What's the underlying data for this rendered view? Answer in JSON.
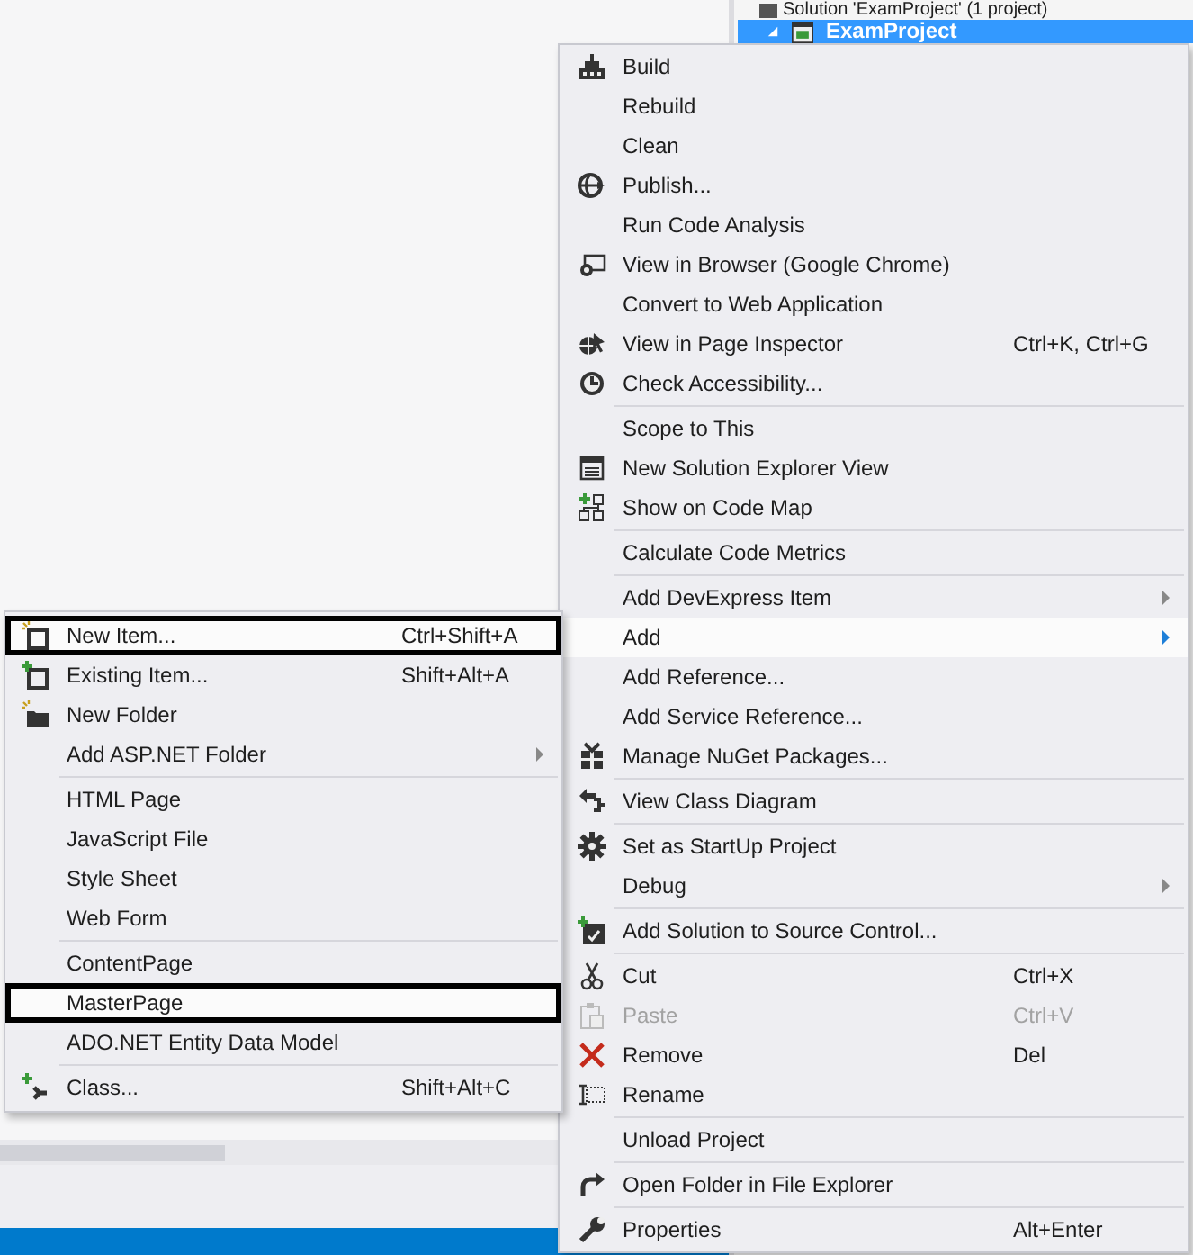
{
  "solution_explorer": {
    "root": "Solution 'ExamProject' (1 project)",
    "project": {
      "label": "ExamProject",
      "expanded": true,
      "selected": true
    }
  },
  "context_menu": {
    "items": [
      {
        "kind": "item",
        "label": "Build",
        "submenu": false,
        "disabled": false,
        "selected": false
      },
      {
        "kind": "item",
        "label": "Rebuild",
        "submenu": false,
        "disabled": false,
        "selected": false
      },
      {
        "kind": "item",
        "label": "Clean",
        "submenu": false,
        "disabled": false,
        "selected": false
      },
      {
        "kind": "item",
        "label": "Publish...",
        "submenu": false,
        "disabled": false,
        "selected": false
      },
      {
        "kind": "item",
        "label": "Run Code Analysis",
        "submenu": false,
        "disabled": false,
        "selected": false
      },
      {
        "kind": "item",
        "label": "View in Browser (Google Chrome)",
        "submenu": false,
        "disabled": false,
        "selected": false
      },
      {
        "kind": "item",
        "label": "Convert to Web Application",
        "submenu": false,
        "disabled": false,
        "selected": false
      },
      {
        "kind": "item",
        "label": "View in Page Inspector",
        "shortcut": "Ctrl+K, Ctrl+G",
        "submenu": false,
        "disabled": false,
        "selected": false
      },
      {
        "kind": "item",
        "label": "Check Accessibility...",
        "submenu": false,
        "disabled": false,
        "selected": false
      },
      {
        "kind": "separator"
      },
      {
        "kind": "item",
        "label": "Scope to This",
        "submenu": false,
        "disabled": false,
        "selected": false
      },
      {
        "kind": "item",
        "label": "New Solution Explorer View",
        "submenu": false,
        "disabled": false,
        "selected": false
      },
      {
        "kind": "item",
        "label": "Show on Code Map",
        "submenu": false,
        "disabled": false,
        "selected": false
      },
      {
        "kind": "separator"
      },
      {
        "kind": "item",
        "label": "Calculate Code Metrics",
        "submenu": false,
        "disabled": false,
        "selected": false
      },
      {
        "kind": "separator"
      },
      {
        "kind": "item",
        "label": "Add DevExpress Item",
        "submenu": true,
        "disabled": false,
        "selected": false
      },
      {
        "kind": "item",
        "label": "Add",
        "submenu": true,
        "disabled": false,
        "selected": true
      },
      {
        "kind": "item",
        "label": "Add Reference...",
        "submenu": false,
        "disabled": false,
        "selected": false
      },
      {
        "kind": "item",
        "label": "Add Service Reference...",
        "submenu": false,
        "disabled": false,
        "selected": false
      },
      {
        "kind": "item",
        "label": "Manage NuGet Packages...",
        "submenu": false,
        "disabled": false,
        "selected": false
      },
      {
        "kind": "separator"
      },
      {
        "kind": "item",
        "label": "View Class Diagram",
        "submenu": false,
        "disabled": false,
        "selected": false
      },
      {
        "kind": "separator"
      },
      {
        "kind": "item",
        "label": "Set as StartUp Project",
        "submenu": false,
        "disabled": false,
        "selected": false
      },
      {
        "kind": "item",
        "label": "Debug",
        "submenu": true,
        "disabled": false,
        "selected": false
      },
      {
        "kind": "separator"
      },
      {
        "kind": "item",
        "label": "Add Solution to Source Control...",
        "submenu": false,
        "disabled": false,
        "selected": false
      },
      {
        "kind": "separator"
      },
      {
        "kind": "item",
        "label": "Cut",
        "shortcut": "Ctrl+X",
        "submenu": false,
        "disabled": false,
        "selected": false
      },
      {
        "kind": "item",
        "label": "Paste",
        "shortcut": "Ctrl+V",
        "submenu": false,
        "disabled": true,
        "selected": false
      },
      {
        "kind": "item",
        "label": "Remove",
        "shortcut": "Del",
        "submenu": false,
        "disabled": false,
        "selected": false
      },
      {
        "kind": "item",
        "label": "Rename",
        "submenu": false,
        "disabled": false,
        "selected": false
      },
      {
        "kind": "separator"
      },
      {
        "kind": "item",
        "label": "Unload Project",
        "submenu": false,
        "disabled": false,
        "selected": false
      },
      {
        "kind": "separator"
      },
      {
        "kind": "item",
        "label": "Open Folder in File Explorer",
        "submenu": false,
        "disabled": false,
        "selected": false
      },
      {
        "kind": "separator"
      },
      {
        "kind": "item",
        "label": "Properties",
        "shortcut": "Alt+Enter",
        "submenu": false,
        "disabled": false,
        "selected": false
      }
    ]
  },
  "add_submenu": {
    "items": [
      {
        "kind": "item",
        "label": "New Item...",
        "shortcut": "Ctrl+Shift+A",
        "submenu": false,
        "selected": true,
        "outlined": true
      },
      {
        "kind": "item",
        "label": "Existing Item...",
        "shortcut": "Shift+Alt+A",
        "submenu": false,
        "selected": false,
        "outlined": false
      },
      {
        "kind": "item",
        "label": "New Folder",
        "submenu": false,
        "selected": false,
        "outlined": false
      },
      {
        "kind": "item",
        "label": "Add ASP.NET Folder",
        "submenu": true,
        "selected": false,
        "outlined": false
      },
      {
        "kind": "separator"
      },
      {
        "kind": "item",
        "label": "HTML Page",
        "submenu": false,
        "selected": false,
        "outlined": false
      },
      {
        "kind": "item",
        "label": "JavaScript File",
        "submenu": false,
        "selected": false,
        "outlined": false
      },
      {
        "kind": "item",
        "label": "Style Sheet",
        "submenu": false,
        "selected": false,
        "outlined": false
      },
      {
        "kind": "item",
        "label": "Web Form",
        "submenu": false,
        "selected": false,
        "outlined": false
      },
      {
        "kind": "separator"
      },
      {
        "kind": "item",
        "label": "ContentPage",
        "submenu": false,
        "selected": false,
        "outlined": false
      },
      {
        "kind": "item",
        "label": "MasterPage",
        "submenu": false,
        "selected": true,
        "outlined": true
      },
      {
        "kind": "item",
        "label": "ADO.NET Entity Data Model",
        "submenu": false,
        "selected": false,
        "outlined": false
      },
      {
        "kind": "separator"
      },
      {
        "kind": "item",
        "label": "Class...",
        "shortcut": "Shift+Alt+C",
        "submenu": false,
        "selected": false,
        "outlined": false
      }
    ]
  }
}
